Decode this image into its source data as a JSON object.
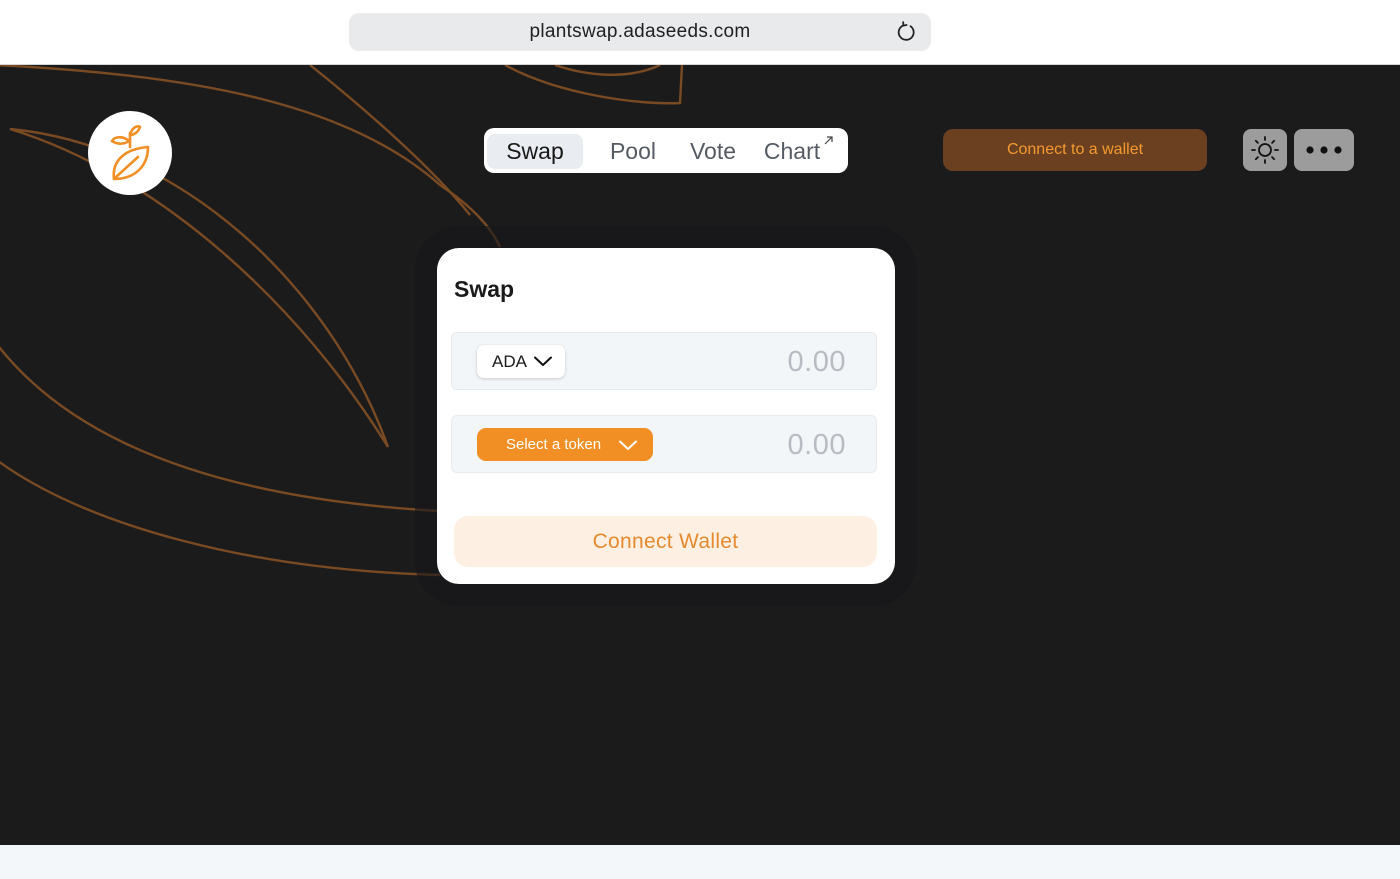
{
  "browser": {
    "url": "plantswap.adaseeds.com",
    "reload_icon": "reload-icon"
  },
  "header": {
    "logo_icon": "plant-leaf-logo-icon",
    "tabs": [
      {
        "label": "Swap",
        "active": true
      },
      {
        "label": "Pool",
        "active": false
      },
      {
        "label": "Vote",
        "active": false
      },
      {
        "label": "Chart",
        "active": false,
        "external_icon": "external-link-icon"
      }
    ],
    "wallet_button": "Connect to a wallet",
    "theme_icon": "sun-icon",
    "more_icon": "more-dots-icon"
  },
  "swap": {
    "title": "Swap",
    "from": {
      "token": "ADA",
      "amount_placeholder": "0.00"
    },
    "to": {
      "token_select": "Select a token",
      "amount_placeholder": "0.00"
    },
    "connect_button": "Connect Wallet"
  },
  "colors": {
    "accent": "#f28f24",
    "background": "#1b1b1c",
    "wallet_button_bg": "#6b4020",
    "leaf_outline": "#7a4a22"
  }
}
